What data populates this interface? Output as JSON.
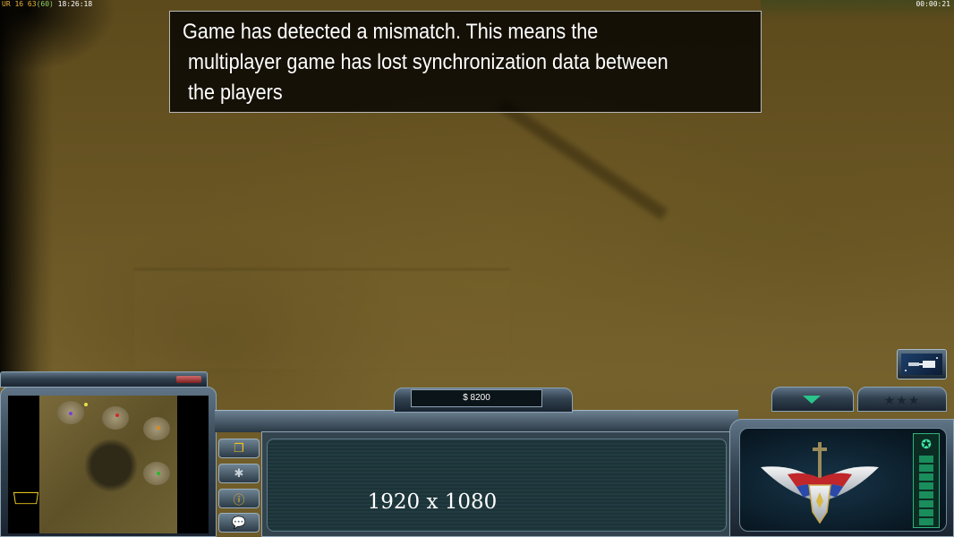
{
  "debug": {
    "ur_label": "UR",
    "stats": "16 63",
    "fps_paren": "(60)",
    "clock": "18:26:18",
    "game_timer": "00:00:21"
  },
  "message": {
    "line1": "Game has detected a mismatch. This means the",
    "line2": "multiplayer game has lost synchronization data between",
    "line3": "the players"
  },
  "hud": {
    "money": "$ 8200",
    "resolution": "1920 x 1080",
    "rank_stars": "★★★",
    "buttons": [
      "control-bar-icon",
      "generals-powers-icon",
      "alert-icon",
      "chat-icon"
    ]
  }
}
